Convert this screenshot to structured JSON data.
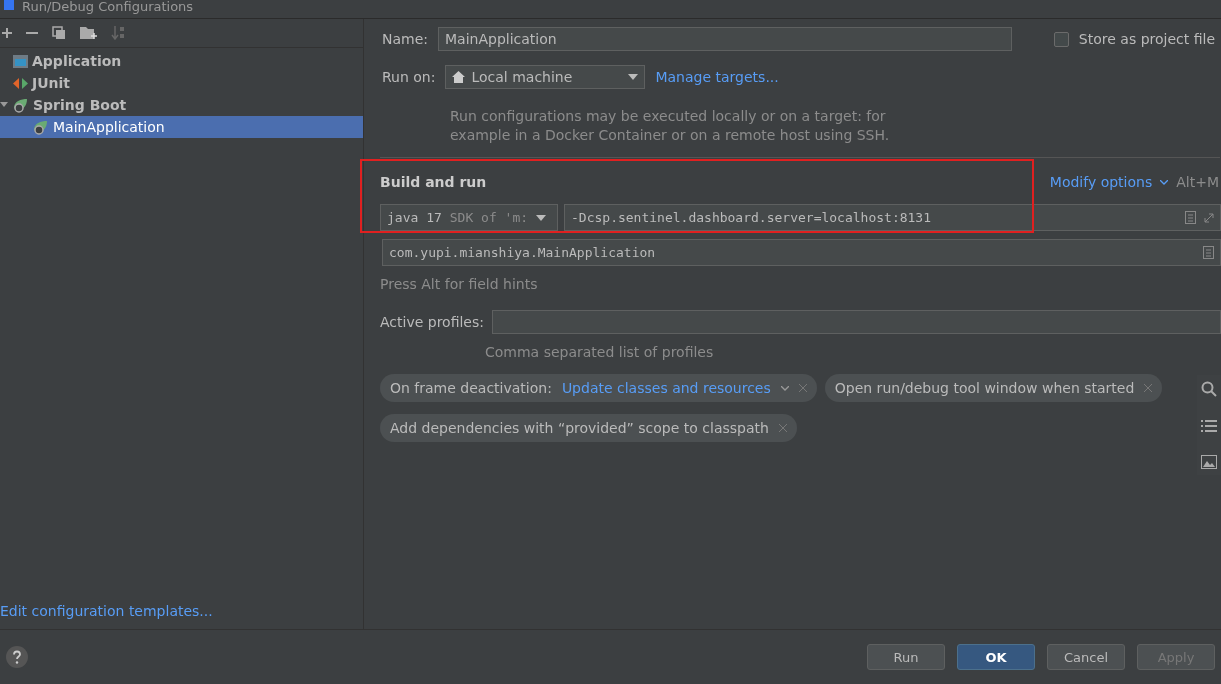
{
  "window": {
    "title": "Run/Debug Configurations"
  },
  "tree": [
    {
      "label": "Application",
      "kind": "application",
      "selected": false
    },
    {
      "label": "JUnit",
      "kind": "junit",
      "selected": false
    },
    {
      "label": "Spring Boot",
      "kind": "spring",
      "selected": false,
      "expanded": true,
      "children": [
        {
          "label": "MainApplication",
          "kind": "spring",
          "selected": true
        }
      ]
    }
  ],
  "templates_link": "Edit configuration templates...",
  "form": {
    "name_label": "Name:",
    "name_value": "MainApplication",
    "store_label": "Store as project file",
    "store_checked": false,
    "run_on_label": "Run on:",
    "run_on_value": "Local machine",
    "manage_link": "Manage targets...",
    "run_on_hint": "Run configurations may be executed locally or on a target: for example in a Docker Container or on a remote host using SSH."
  },
  "build": {
    "title": "Build and run",
    "modify": "Modify options",
    "shortcut": "Alt+M",
    "sdk": "java 17",
    "sdk_hint": "SDK of 'm:",
    "vm_options": "-Dcsp.sentinel.dashboard.server=localhost:8131",
    "main_class": "com.yupi.mianshiya.MainApplication",
    "field_hint": "Press Alt for field hints"
  },
  "profiles": {
    "label": "Active profiles:",
    "hint": "Comma separated list of profiles"
  },
  "chips": [
    {
      "label": "On frame deactivation:",
      "value": "Update classes and resources"
    },
    {
      "label": "Open run/debug tool window when started"
    },
    {
      "label": "Add dependencies with “provided” scope to classpath"
    }
  ],
  "buttons": [
    {
      "label": "Run",
      "kind": "normal",
      "disabled": false
    },
    {
      "label": "OK",
      "kind": "default",
      "disabled": false
    },
    {
      "label": "Cancel",
      "kind": "normal",
      "disabled": false
    },
    {
      "label": "Apply",
      "kind": "normal",
      "disabled": true
    }
  ]
}
